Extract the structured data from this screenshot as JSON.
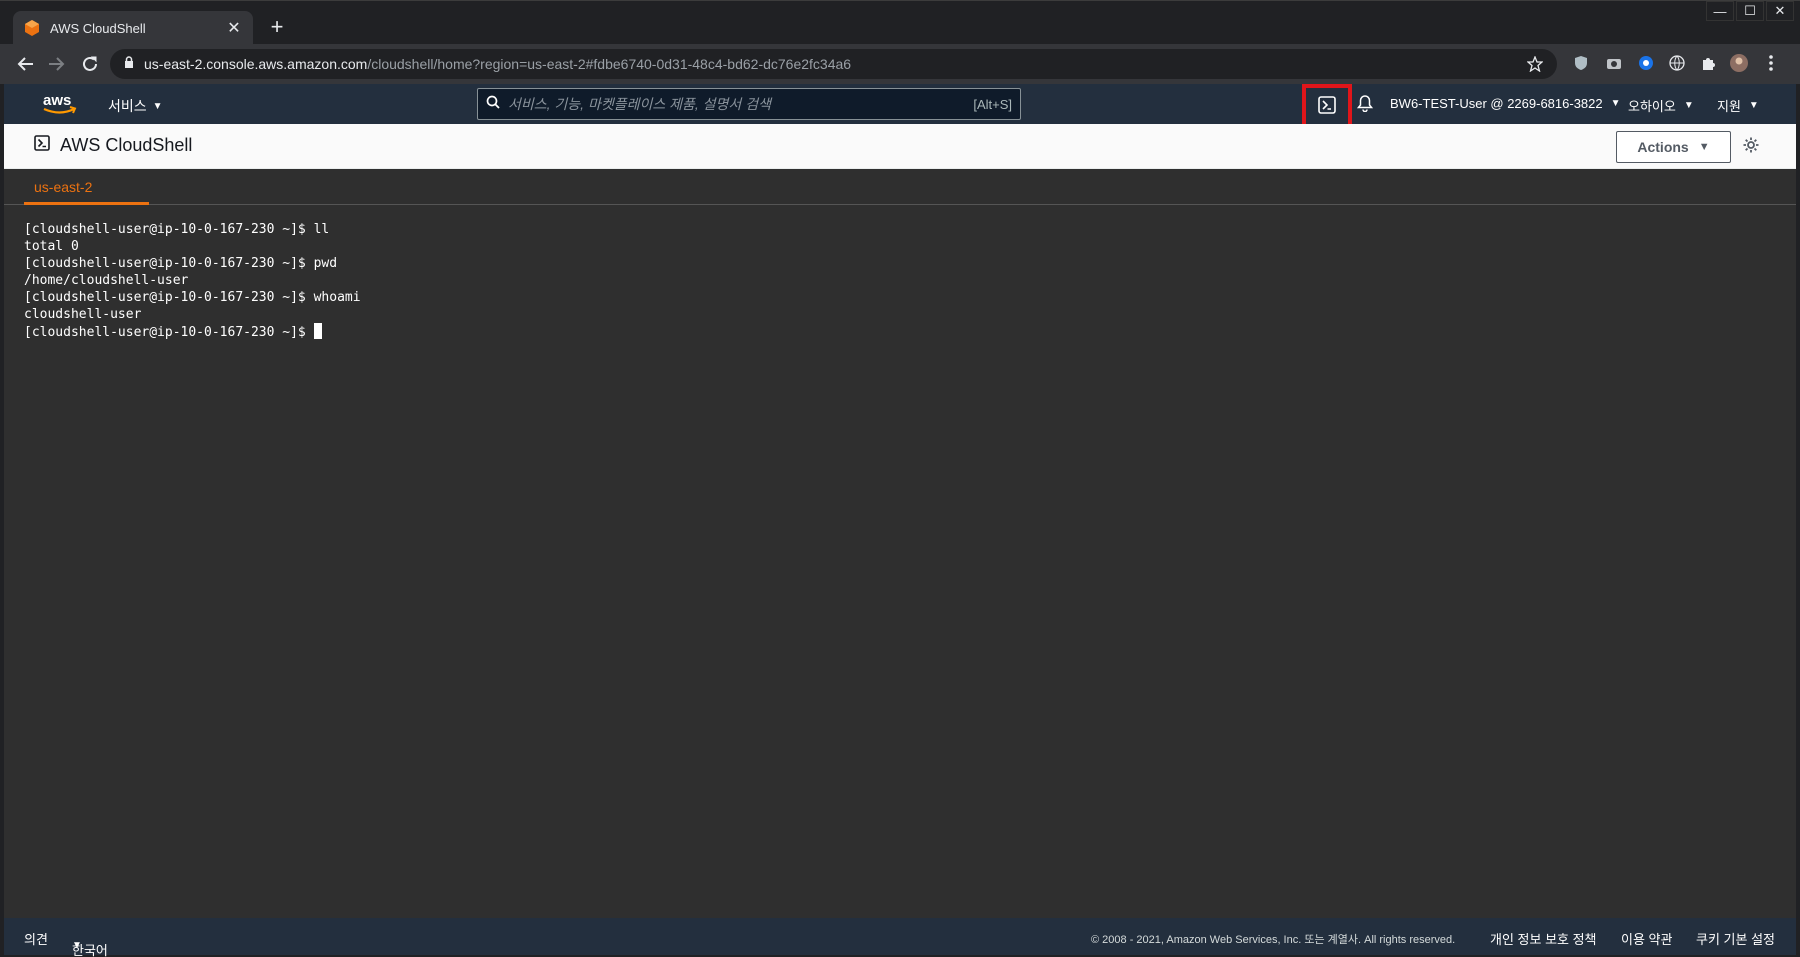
{
  "browser": {
    "tab_title": "AWS CloudShell",
    "url_host": "us-east-2.console.aws.amazon.com",
    "url_path": "/cloudshell/home?region=us-east-2#fdbe6740-0d31-48c4-bd62-dc76e2fc34a6"
  },
  "aws_nav": {
    "services_label": "서비스",
    "search_placeholder": "서비스, 기능, 마켓플레이스 제품, 설명서 검색",
    "search_shortcut": "[Alt+S]",
    "account_label": "BW6-TEST-User @ 2269-6816-3822",
    "region_label": "오하이오",
    "support_label": "지원"
  },
  "cloudshell": {
    "title": "AWS CloudShell",
    "actions_label": "Actions",
    "region_tab": "us-east-2"
  },
  "terminal": {
    "lines": [
      "[cloudshell-user@ip-10-0-167-230 ~]$ ll",
      "total 0",
      "[cloudshell-user@ip-10-0-167-230 ~]$ pwd",
      "/home/cloudshell-user",
      "[cloudshell-user@ip-10-0-167-230 ~]$ whoami",
      "cloudshell-user",
      "[cloudshell-user@ip-10-0-167-230 ~]$ "
    ]
  },
  "footer": {
    "feedback": "의견",
    "language": "한국어",
    "copyright": "© 2008 - 2021, Amazon Web Services, Inc. 또는 계열사. All rights reserved.",
    "privacy": "개인 정보 보호 정책",
    "terms": "이용 약관",
    "cookies": "쿠키 기본 설정"
  },
  "colors": {
    "aws_nav_bg": "#232f3e",
    "accent_orange": "#ec7211",
    "terminal_bg": "#2f2f2f",
    "highlight_red": "#e0151a"
  }
}
